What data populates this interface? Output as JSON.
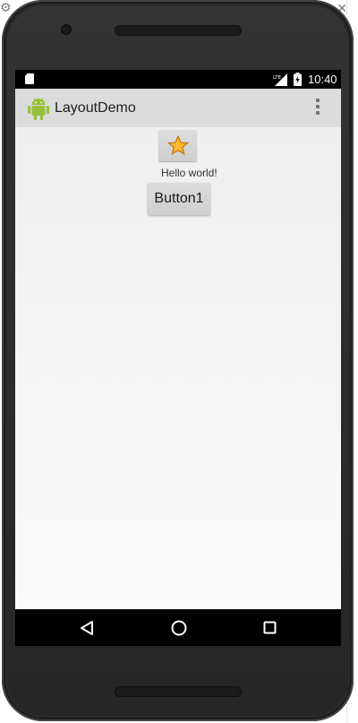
{
  "app": {
    "title": "LayoutDemo"
  },
  "statusbar": {
    "time": "10:40",
    "network_label": "LTE",
    "icons": [
      "sd-card-icon",
      "lte-signal-icon",
      "battery-icon"
    ]
  },
  "actionbar": {
    "logo_icon": "android-robot-icon",
    "menu_icon": "overflow-menu-icon"
  },
  "content": {
    "image_button_icon": "star-icon",
    "hello_text": "Hello world!",
    "button1_label": "Button1"
  },
  "navbar": {
    "icons": [
      "back-triangle-icon",
      "home-circle-icon",
      "recents-square-icon"
    ]
  },
  "colors": {
    "statusbar": "#000000",
    "actionbar": "#dcdcdc",
    "android_green": "#97c03b",
    "star_fill": "#f7a81b",
    "phone_body": "#2a2a2a"
  }
}
